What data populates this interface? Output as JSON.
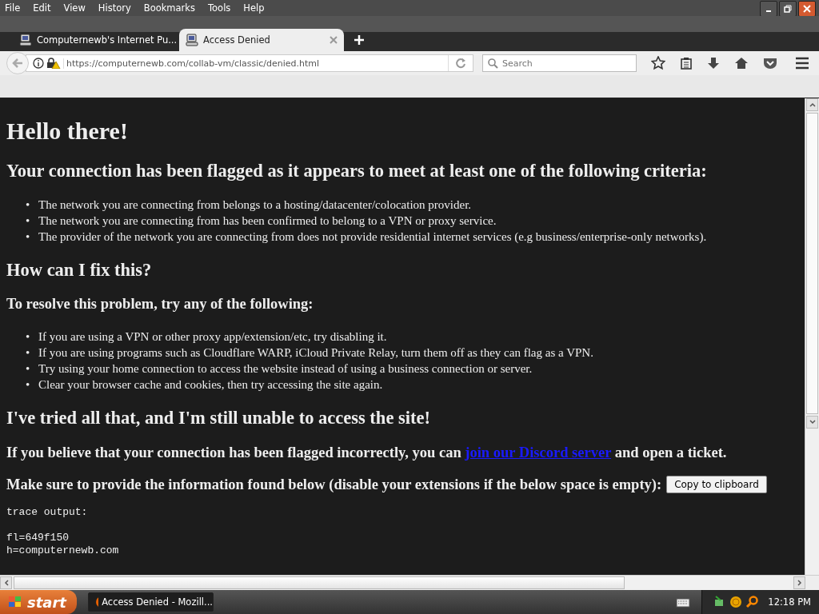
{
  "menu": [
    "File",
    "Edit",
    "View",
    "History",
    "Bookmarks",
    "Tools",
    "Help"
  ],
  "tabs": [
    {
      "title": "Computernewb's Internet Pu...",
      "selected": false
    },
    {
      "title": "Access Denied",
      "selected": true
    }
  ],
  "address": {
    "url": "https://computernewb.com/collab-vm/classic/denied.html"
  },
  "search": {
    "placeholder": "Search"
  },
  "page": [
    {
      "kind": "h1",
      "text": "Hello there!"
    },
    {
      "kind": "h2",
      "text": "Your connection has been flagged as it appears to meet at least one of the following criteria:"
    },
    {
      "kind": "list",
      "items": [
        {
          "bullet": "•",
          "text": "The network you are connecting from belongs to a hosting/datacenter/colocation provider."
        },
        {
          "bullet": "•",
          "text": "The network you are connecting from has been confirmed to belong to a VPN or proxy service."
        },
        {
          "bullet": "•",
          "text": "The provider of the network you are connecting from does not provide residential internet services (e.g business/enterprise-only networks)."
        }
      ]
    },
    {
      "kind": "h2",
      "text": "How can I fix this?"
    },
    {
      "kind": "h3",
      "text": "To resolve this problem, try any of the following:"
    },
    {
      "kind": "list",
      "items": [
        {
          "bullet": "•",
          "text": "If you are using a VPN or other proxy app/extension/etc, try disabling it."
        },
        {
          "bullet": "•",
          "text": "If you are using programs such as Cloudflare WARP, iCloud Private Relay, turn them off as they can flag as a VPN."
        },
        {
          "bullet": "•",
          "text": "Try using your home connection to access the website instead of using a business connection or server."
        },
        {
          "bullet": "•",
          "text": "Clear your browser cache and cookies, then try accessing the site again."
        }
      ]
    },
    {
      "kind": "h2",
      "text": "I've tried all that, and I'm still unable to access the site!"
    },
    {
      "kind": "link_para",
      "before": "If you believe that your connection has been flagged incorrectly, you can",
      "link": "join our Discord server",
      "after": "and open a ticket."
    },
    {
      "kind": "button_para",
      "text": "Make sure to provide the information found below (disable your extensions if the below space is empty):",
      "button": "Copy to clipboard"
    },
    {
      "kind": "pre",
      "header": "trace output:",
      "lines": [
        "fl=649f150",
        "h=computernewb.com"
      ]
    }
  ],
  "taskbar": {
    "start": "start",
    "tasks": [
      {
        "title": "Access Denied - Mozill...",
        "selected": true
      }
    ],
    "clock": "12:18 PM"
  }
}
